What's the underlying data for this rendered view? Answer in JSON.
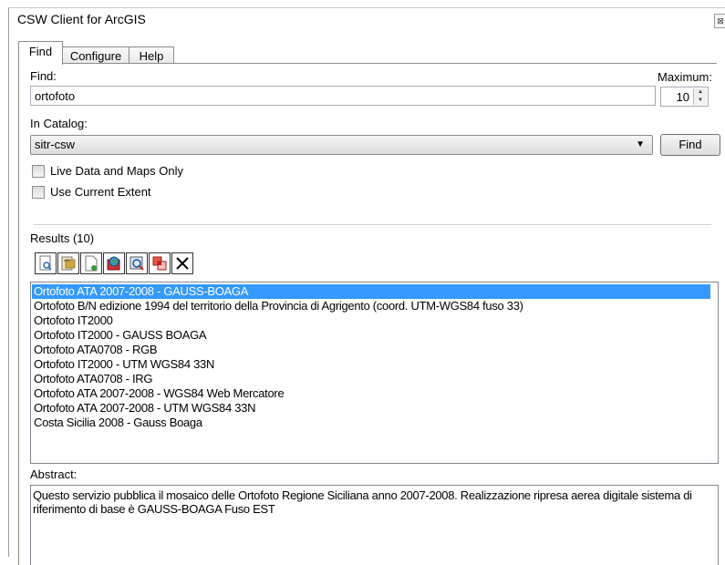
{
  "window": {
    "title": "CSW Client for ArcGIS",
    "close_glyph": "⊠"
  },
  "tabs": [
    {
      "label": "Find"
    },
    {
      "label": "Configure"
    },
    {
      "label": "Help"
    }
  ],
  "find": {
    "find_label": "Find:",
    "query_value": "ortofoto",
    "maximum_label": "Maximum:",
    "maximum_value": "10",
    "catalog_label": "In Catalog:",
    "catalog_selected": "sitr-csw",
    "find_button": "Find",
    "live_data_label": "Live Data and Maps Only",
    "current_extent_label": "Use Current Extent"
  },
  "results": {
    "label": "Results (10)",
    "toolbar_icons": [
      "view-metadata-icon",
      "edit-metadata-icon",
      "add-document-icon",
      "add-to-map-icon",
      "zoom-to-extent-icon",
      "clip-icon",
      "clear-icon"
    ],
    "items": [
      "Ortofoto ATA 2007-2008 - GAUSS-BOAGA",
      "Ortofoto B/N edizione 1994 del territorio della Provincia di Agrigento (coord. UTM-WGS84 fuso 33)",
      "Ortofoto IT2000",
      "Ortofoto IT2000 - GAUSS BOAGA",
      "Ortofoto ATA0708 - RGB",
      "Ortofoto IT2000 - UTM WGS84 33N",
      "Ortofoto ATA0708 - IRG",
      "Ortofoto ATA 2007-2008 - WGS84 Web Mercatore",
      "Ortofoto ATA 2007-2008 - UTM WGS84 33N",
      "Costa Sicilia 2008 - Gauss Boaga"
    ],
    "selected_index": 0
  },
  "abstract": {
    "label": "Abstract:",
    "text": "Questo servizio pubblica il mosaico delle Ortofoto Regione Siciliana anno 2007-2008. Realizzazione ripresa aerea digitale sistema di riferimento di base è GAUSS-BOAGA Fuso EST"
  },
  "colors": {
    "selection": "#3399ff",
    "border": "#828790"
  }
}
